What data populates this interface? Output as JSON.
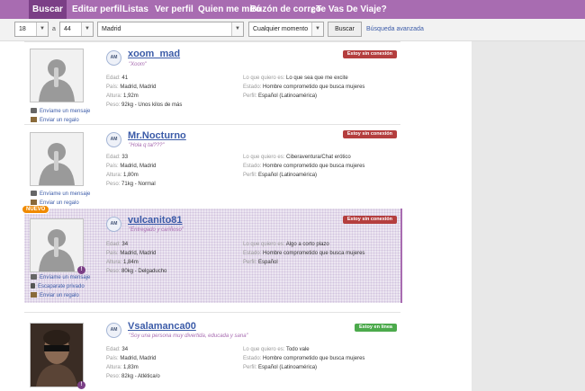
{
  "nav": {
    "items": [
      {
        "label": "Buscar",
        "active": true
      },
      {
        "label": "Editar perfil"
      },
      {
        "label": "Listas"
      },
      {
        "label": "Ver perfil"
      },
      {
        "label": "Quien me miró"
      },
      {
        "label": "Buzón de correo"
      },
      {
        "label": "¿Te Vas De Viaje?"
      }
    ]
  },
  "search": {
    "age_min": "18",
    "age_separator": "a",
    "age_max": "44",
    "location": "Madrid",
    "time": "Cualquier momento",
    "button": "Buscar",
    "advanced": "Búsqueda avanzada"
  },
  "labels": {
    "age": "Edad:",
    "country": "País:",
    "height": "Altura:",
    "weight": "Peso:",
    "wants": "Lo que quiero es:",
    "status": "Estado:",
    "profile": "Perfil:"
  },
  "colors": {
    "nav_bg": "#a86cb1",
    "nav_active": "#7b3f86",
    "link": "#3b5ba8",
    "offline": "#b43e3e",
    "online": "#4caa4c",
    "new_badge": "#f08a00"
  },
  "profiles": [
    {
      "avatar_badge": "AM",
      "username": "xoom_mad",
      "motto": "\"Xoom\"",
      "status": "Estoy sin conexión",
      "status_type": "offline",
      "age": "41",
      "country": "Madrid, Madrid",
      "height": "1,92m",
      "weight": "92kg - Unos kilos de más",
      "wants": "Lo que sea que me excite",
      "state": "Hombre comprometido que busca mujeres",
      "profile": "Español (Latinoamérica)",
      "actions": [
        "Envíame un mensaje",
        "Enviar un regalo"
      ],
      "photo_icon": "silhouette-icon"
    },
    {
      "avatar_badge": "AM",
      "username": "Mr.Nocturno",
      "motto": "\"Hola q tal???\"",
      "status": "Estoy sin conexión",
      "status_type": "offline",
      "age": "33",
      "country": "Madrid, Madrid",
      "height": "1,80m",
      "weight": "71kg - Normal",
      "wants": "Ciberaventura/Chat erótico",
      "state": "Hombre comprometido que busca mujeres",
      "profile": "Español (Latinoamérica)",
      "actions": [
        "Envíame un mensaje",
        "Enviar un regalo"
      ],
      "photo_icon": "silhouette-icon"
    },
    {
      "new_badge": "NUEVO",
      "avatar_badge": "AM",
      "username": "vulcanito81",
      "motto": "\"Entregado y cariñoso\"",
      "status": "Estoy sin conexión",
      "status_type": "offline",
      "age": "34",
      "country": "Madrid, Madrid",
      "height": "1,84m",
      "weight": "80kg - Delgaducho",
      "wants": "Algo a corto plazo",
      "state": "Hombre comprometido que busca mujeres",
      "profile": "Español",
      "actions": [
        "Envíame un mensaje",
        "Escaparate privado",
        "Enviar un regalo"
      ],
      "photo_icon": "silhouette-icon"
    },
    {
      "avatar_badge": "AM",
      "username": "Vsalamanca00",
      "motto": "\"Soy una persona muy divertida, educada y sana\"",
      "status": "Estoy en línea",
      "status_type": "online",
      "age": "34",
      "country": "Madrid, Madrid",
      "height": "1,83m",
      "weight": "82kg - Atlética/o",
      "wants": "Todo vale",
      "state": "Hombre comprometido que busca mujeres",
      "profile": "Español (Latinoamérica)",
      "actions": [],
      "photo_icon": "user-photo"
    }
  ]
}
